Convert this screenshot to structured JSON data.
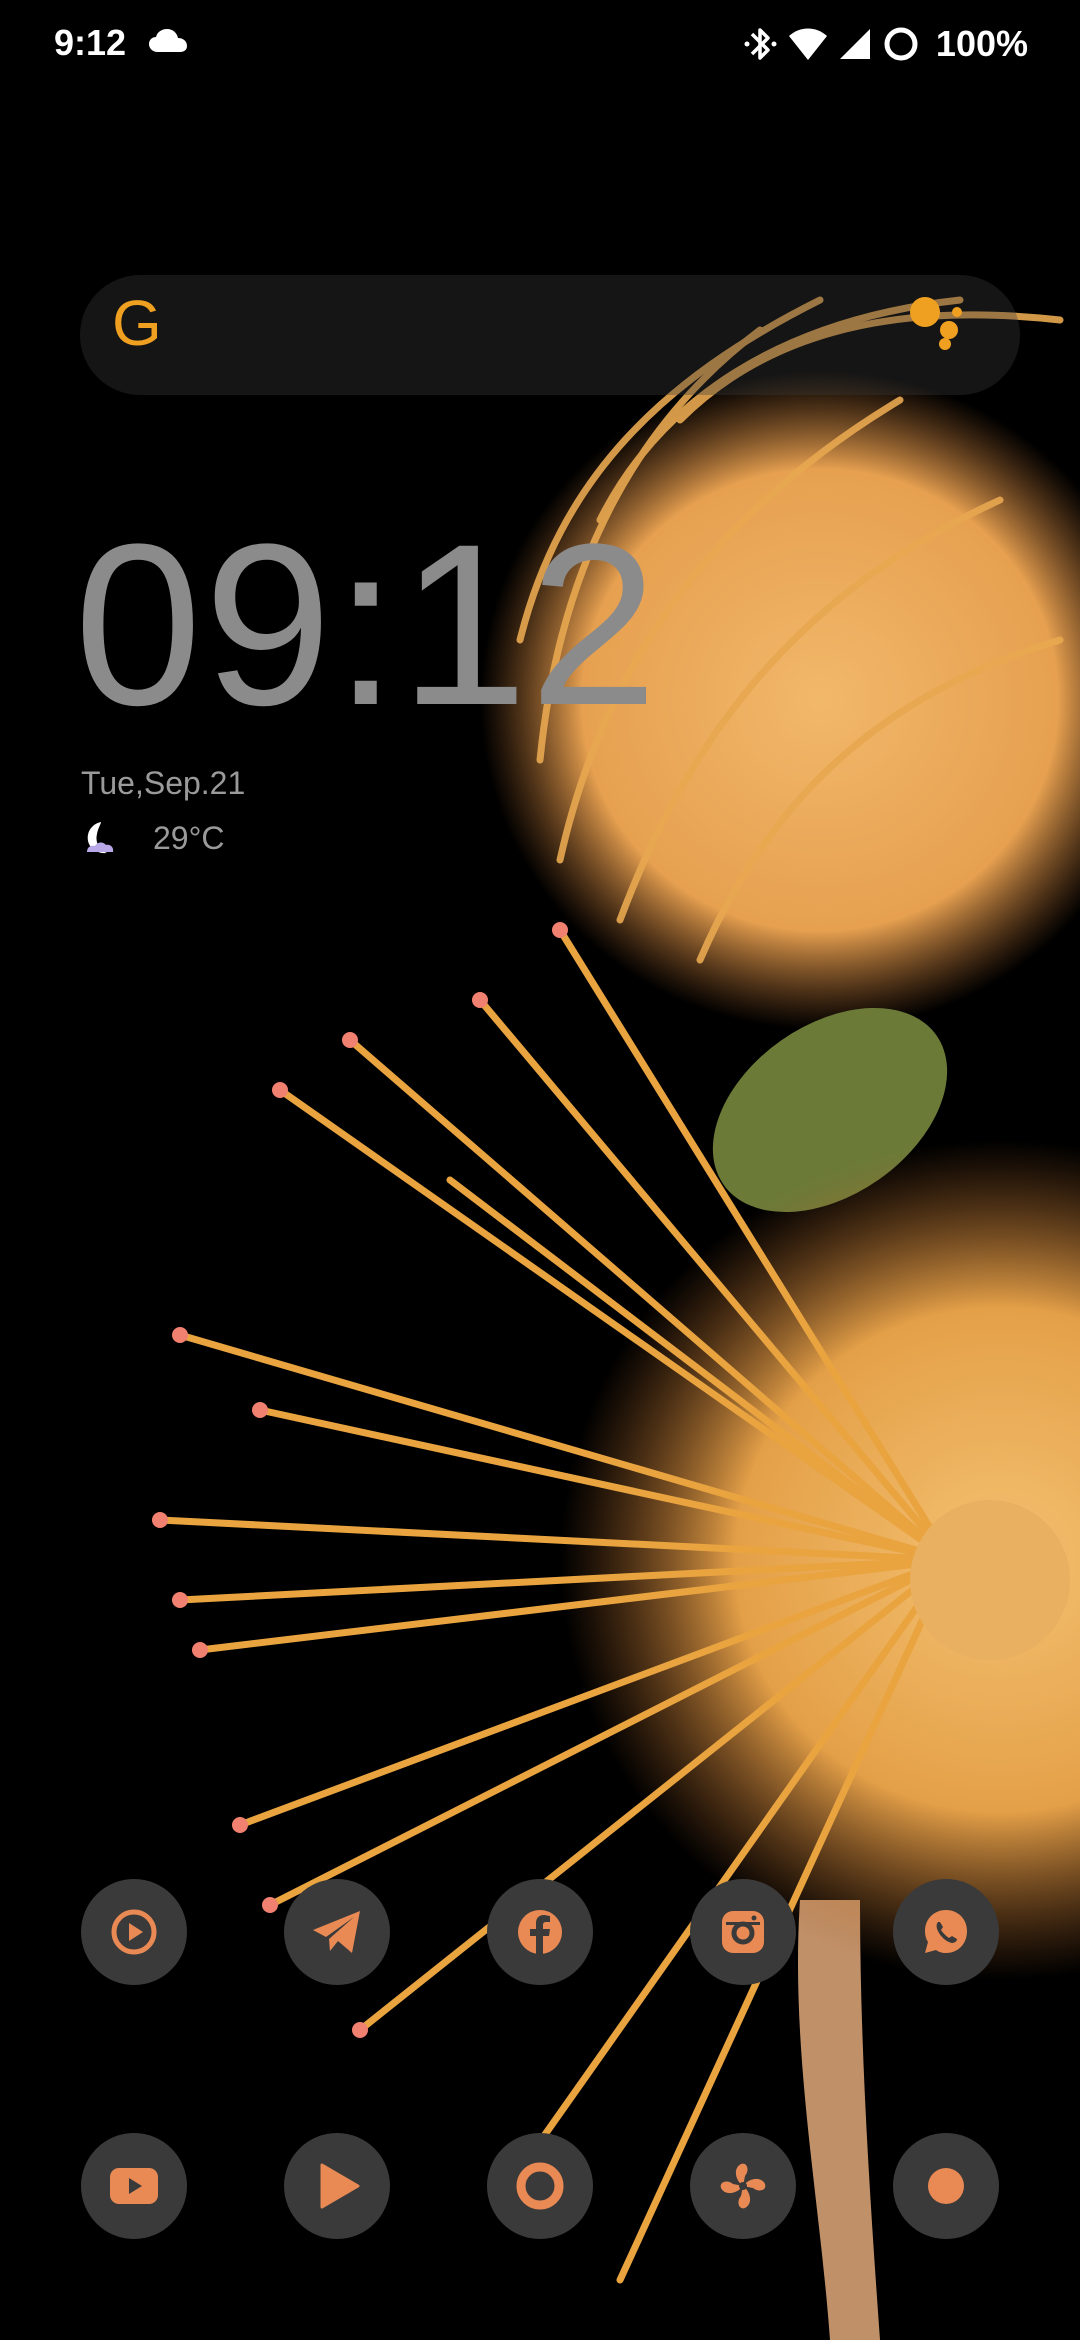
{
  "status_bar": {
    "time": "9:12",
    "battery": "100%",
    "icons": [
      "cloud-icon",
      "bluetooth-icon",
      "wifi-icon",
      "cell-signal-icon",
      "battery-saver-ring-icon"
    ]
  },
  "search": {
    "logo_letter": "G",
    "logo_color": "#f0a020",
    "assistant_icon": "assistant-dots-icon"
  },
  "clock": {
    "time": "09:12",
    "date": "Tue,Sep.21",
    "weather_icon": "moon-cloud-icon",
    "temperature": "29°C"
  },
  "apps": {
    "accent_color": "#e98a54",
    "row1": [
      "play-circle-icon",
      "telegram-icon",
      "facebook-icon",
      "instagram-icon",
      "whatsapp-icon"
    ],
    "row2": [
      "youtube-icon",
      "play-store-icon",
      "record-icon",
      "fan-icon",
      "screen-record-dot-icon"
    ]
  }
}
